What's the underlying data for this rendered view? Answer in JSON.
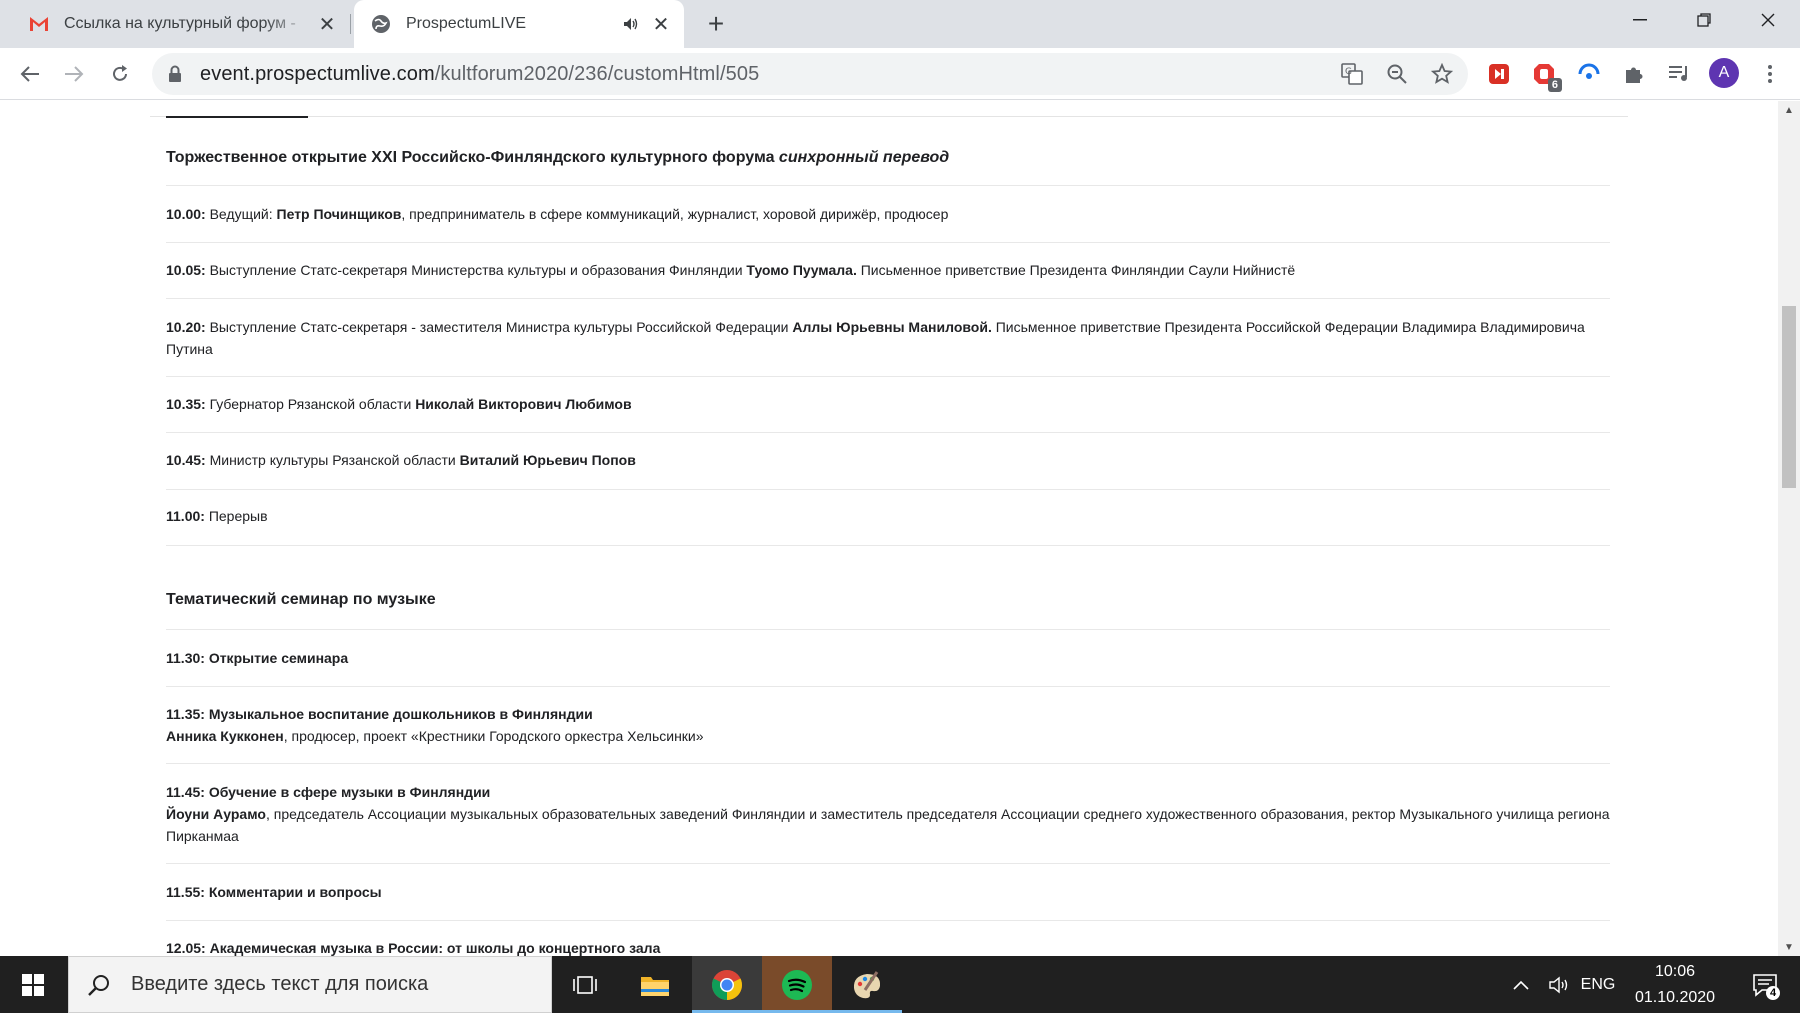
{
  "tabs": [
    {
      "title": "Ссылка на культурный форум -",
      "icon": "gmail-icon"
    },
    {
      "title": "ProspectumLIVE",
      "icon": "globe-icon"
    }
  ],
  "address_bar": {
    "host": "event.prospectumlive.com",
    "path": "/kultforum2020/236/customHtml/505"
  },
  "profile_initial": "A",
  "extension_badge": "6",
  "sections": [
    {
      "title": "Торжественное открытие XXI Российско-Финляндского культурного форума",
      "title_suffix": "синхронный перевод",
      "items": [
        {
          "time": "10.00:",
          "pre": " Ведущий: ",
          "bold": "Петр Починщиков",
          "post": ", предприниматель в сфере коммуникаций, журналист, хоровой дирижёр, продюсер"
        },
        {
          "time": "10.05:",
          "pre": " Выступление Статс-секретаря Министерства культуры и образования Финляндии ",
          "bold": "Туомо Пуумала.",
          "post": " Письменное приветствие Президента Финляндии Саули Нийнистё"
        },
        {
          "time": "10.20:",
          "pre": " Выступление Статс-секретаря - заместителя Министра культуры Российской Федерации ",
          "bold": "Аллы Юрьевны Маниловой.",
          "post": " Письменное приветствие Президента Российской Федерации Владимира Владимировича Путина"
        },
        {
          "time": "10.35:",
          "pre": " Губернатор Рязанской области ",
          "bold": "Николай Викторович Любимов",
          "post": ""
        },
        {
          "time": "10.45:",
          "pre": " Министр культуры Рязанской области ",
          "bold": "Виталий Юрьевич Попов",
          "post": ""
        },
        {
          "time": "11.00:",
          "pre": " Перерыв",
          "bold": "",
          "post": ""
        }
      ]
    },
    {
      "title": "Тематический семинар по музыке",
      "title_suffix": "",
      "items": [
        {
          "heading": "11.30: Открытие семинара",
          "speaker": "",
          "speaker_desc": ""
        },
        {
          "heading": "11.35: Музыкальное воспитание дошкольников в Финляндии",
          "speaker": "Анника Кукконен",
          "speaker_desc": ", продюсер, проект «Крестники Городского оркестра Хельсинки»"
        },
        {
          "heading": "11.45: Обучение в сфере музыки в Финляндии",
          "speaker": "Йоуни Аурамо",
          "speaker_desc": ", председатель Ассоциации музыкальных образовательных заведений Финляндии и заместитель председателя Ассоциации среднего художественного образования, ректор Музыкального училища региона Пирканмаа"
        },
        {
          "heading": "11.55: Комментарии и вопросы",
          "speaker": "",
          "speaker_desc": ""
        },
        {
          "heading": "12.05: Академическая музыка в России: от школы до концертного зала",
          "speaker": "",
          "speaker_desc": ""
        }
      ]
    }
  ],
  "taskbar": {
    "search_placeholder": "Введите здесь текст для поиска",
    "language": "ENG",
    "time": "10:06",
    "date": "01.10.2020",
    "notification_count": "4"
  }
}
